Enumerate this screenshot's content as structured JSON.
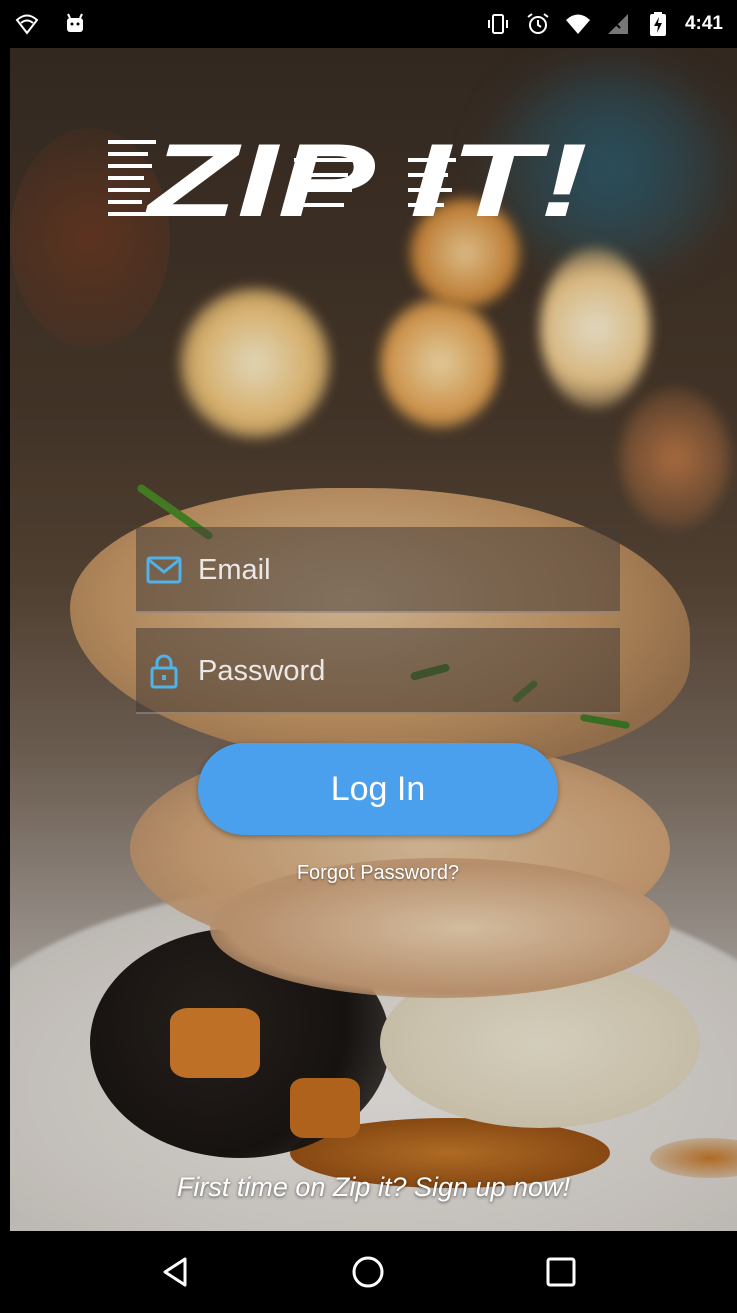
{
  "status_bar": {
    "time": "4:41",
    "icons": [
      "wifi-outline-icon",
      "android-debug-icon",
      "vibrate-icon",
      "alarm-icon",
      "wifi-icon",
      "no-signal-icon",
      "battery-charging-icon"
    ]
  },
  "app": {
    "logo_text": "ZIP IT!",
    "email": {
      "placeholder": "Email",
      "icon": "mail-icon"
    },
    "password": {
      "placeholder": "Password",
      "icon": "lock-icon"
    },
    "login_label": "Log In",
    "forgot_label": "Forgot Password?",
    "signup_label": "First time on Zip it? Sign up now!"
  },
  "colors": {
    "accent": "#4aa0ec",
    "icon_blue": "#4fb2e8",
    "status_bar": "#000000",
    "nav_bar": "#000000"
  },
  "nav_bar": {
    "buttons": [
      "back-icon",
      "home-icon",
      "recents-icon"
    ]
  }
}
